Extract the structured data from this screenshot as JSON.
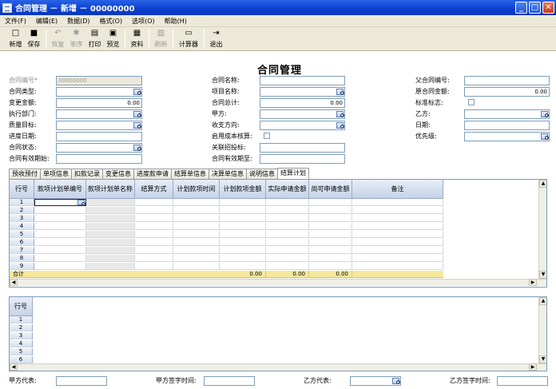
{
  "window": {
    "title": "合同管理 － 新增 － 00000000",
    "btn_min": "_",
    "btn_max": "□",
    "btn_close": "✕"
  },
  "menu": [
    "文件(F)",
    "编辑(E)",
    "数据(D)",
    "格式(O)",
    "选项(O)",
    "帮助(H)"
  ],
  "toolbar": {
    "new": "新增",
    "save": "保存",
    "restore": "恢复",
    "void": "单序",
    "print": "打印",
    "preview": "预览",
    "data": "资料",
    "refresh": "刷新",
    "calc": "计算器",
    "exit": "退出",
    "icons": {
      "new": "□",
      "save": "■",
      "restore": "↶",
      "void": "✱",
      "print": "▤",
      "preview": "▣",
      "data": "▦",
      "refresh": "▥",
      "calc": "▭",
      "exit": "⇥"
    }
  },
  "form": {
    "title": "合同管理",
    "labels": {
      "contract_no": "合同编号*",
      "contract_type": "合同类型:",
      "change_amount": "变更金额:",
      "exec_dept": "执行部门:",
      "quality_target": "质量目标:",
      "progress_date": "进度日期:",
      "contract_status": "合同状态:",
      "valid_from": "合同有效期始:",
      "contract_name": "合同名称:",
      "project_name": "项目名称:",
      "contract_total": "合同总计:",
      "party_a": "甲方:",
      "pay_direction": "收支方向:",
      "enable_cost": "启用成本核算:",
      "related_bid": "关联招投标:",
      "valid_to": "合同有效期至:",
      "parent_contract": "父合同编号:",
      "orig_amount": "原合同金额:",
      "std_flag": "标准标志:",
      "party_b": "乙方:",
      "date": "日期:",
      "priority": "优先级:"
    },
    "values": {
      "contract_no": "00000000",
      "change_amount": "0.00",
      "contract_total": "0.00",
      "orig_amount": "0.00"
    }
  },
  "tabs": [
    "预收预付",
    "单项信息",
    "扣款记录",
    "变更信息",
    "进度款申请",
    "结算单信息",
    "决算单信息",
    "说明信息",
    "结算计划"
  ],
  "grid": {
    "columns": [
      "行号",
      "款项计划单编号",
      "款项计划单名称",
      "结算方式",
      "计划款项时间",
      "计划款项金额",
      "实际申请金额",
      "尚可申请金额",
      "备注"
    ],
    "rows": [
      "1",
      "2",
      "3",
      "4",
      "5",
      "6",
      "7",
      "8",
      "9"
    ],
    "sum_label": "合计",
    "sums": [
      "0.00",
      "0.00",
      "0.00"
    ]
  },
  "grid2": {
    "columns": [
      "行号"
    ],
    "rows": [
      "1",
      "2",
      "3",
      "4",
      "5",
      "6"
    ]
  },
  "bottom": {
    "party_a_rep": "甲方代表:",
    "party_a_sign": "甲方签字时间:",
    "party_b_rep": "乙方代表:",
    "party_b_sign": "乙方签字时间:"
  }
}
